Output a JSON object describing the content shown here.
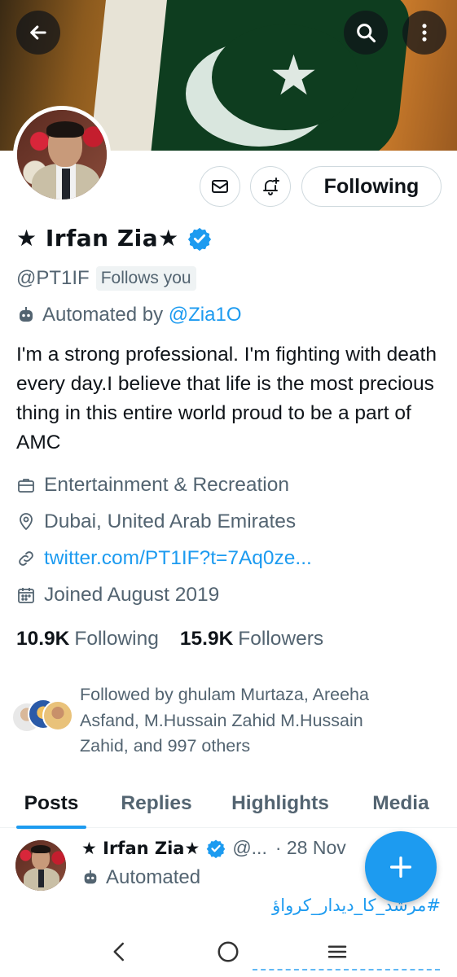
{
  "profile": {
    "name": "★ Irfan Zia★",
    "handle": "@PT1IF",
    "follows_you": "Follows you",
    "automated_prefix": "Automated by",
    "automated_by": "@Zia1O",
    "bio": "I'm a  strong professional. I'm fighting with death every day.I believe that life is the most precious thing in this entire world proud to be a part of AMC",
    "category": "Entertainment & Recreation",
    "location": "Dubai, United Arab Emirates",
    "website": "twitter.com/PT1IF?t=7Aq0ze...",
    "joined": "Joined August 2019",
    "following_count": "10.9K",
    "following_label": "Following",
    "followers_count": "15.9K",
    "followers_label": "Followers",
    "followed_by": "Followed by ghulam Murtaza, Areeha Asfand, M.Hussain Zahid M.Hussain Zahid, and 997 others"
  },
  "actions": {
    "following_button": "Following"
  },
  "tabs": [
    {
      "label": "Posts",
      "active": true
    },
    {
      "label": "Replies",
      "active": false
    },
    {
      "label": "Highlights",
      "active": false
    },
    {
      "label": "Media",
      "active": false
    }
  ],
  "post": {
    "name": "★ Irfan Zia★",
    "handle": "@...",
    "date": "· 28 Nov",
    "automated": "Automated",
    "text": "#مرشد_کا_دیدار_کرواؤ"
  },
  "colors": {
    "accent": "#1d9bf0",
    "text": "#0f1419",
    "secondary": "#536471"
  },
  "icons": [
    "back-arrow-icon",
    "search-icon",
    "more-vertical-icon",
    "mail-icon",
    "bell-plus-icon",
    "verified-badge-icon",
    "bot-icon",
    "briefcase-icon",
    "location-pin-icon",
    "link-icon",
    "calendar-icon",
    "plus-icon",
    "nav-back-icon",
    "nav-home-icon",
    "nav-recents-icon"
  ]
}
